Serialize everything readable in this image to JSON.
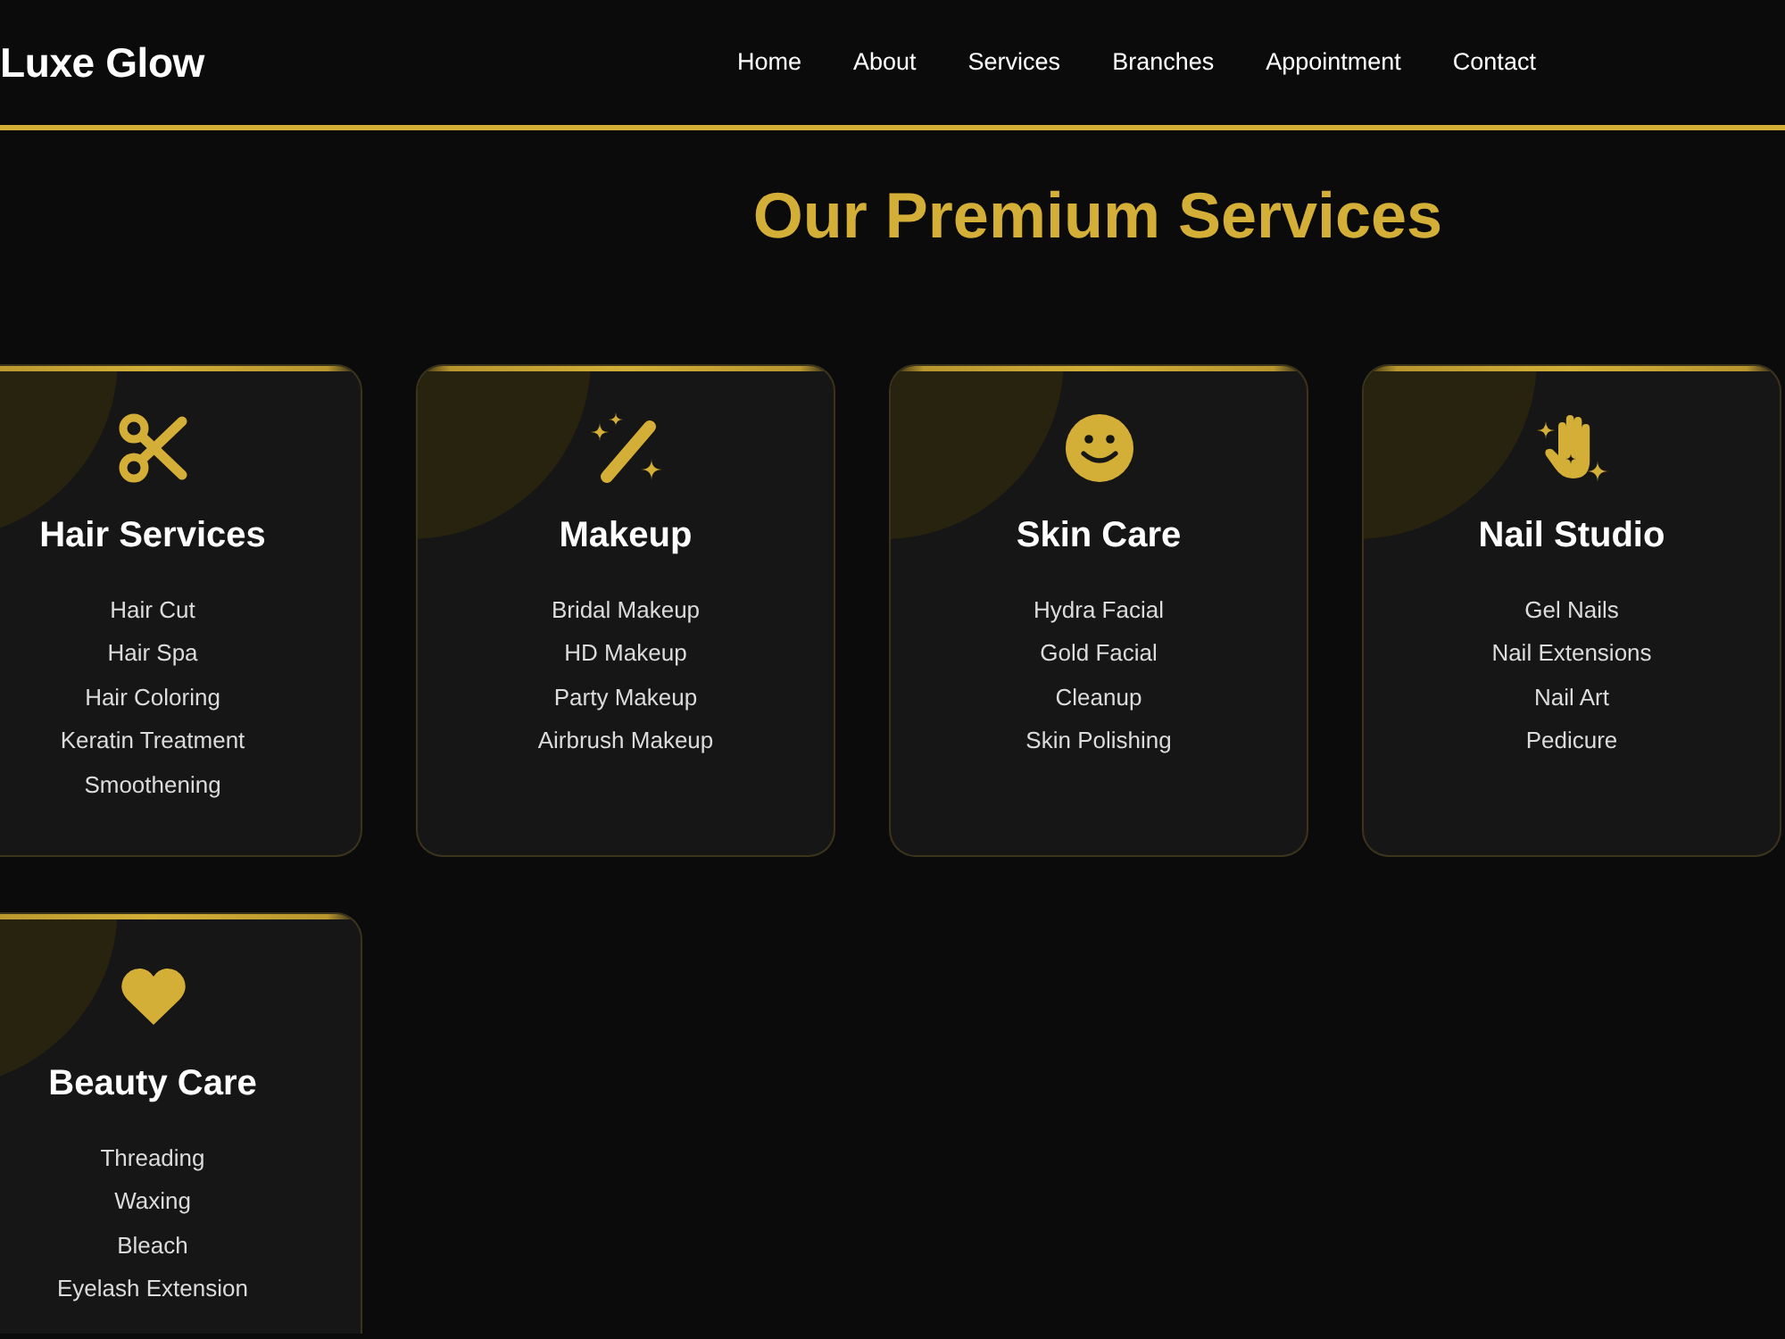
{
  "header": {
    "logo": "Luxe Glow",
    "nav": [
      "Home",
      "About",
      "Services",
      "Branches",
      "Appointment",
      "Contact"
    ]
  },
  "services": {
    "title": "Our Premium Services",
    "cards": [
      {
        "title": "Hair Services",
        "items": [
          "Hair Cut",
          "Hair Spa",
          "Hair Coloring",
          "Keratin Treatment",
          "Smoothening"
        ]
      },
      {
        "title": "Makeup",
        "items": [
          "Bridal Makeup",
          "HD Makeup",
          "Party Makeup",
          "Airbrush Makeup"
        ]
      },
      {
        "title": "Skin Care",
        "items": [
          "Hydra Facial",
          "Gold Facial",
          "Cleanup",
          "Skin Polishing"
        ]
      },
      {
        "title": "Nail Studio",
        "items": [
          "Gel Nails",
          "Nail Extensions",
          "Nail Art",
          "Pedicure"
        ]
      },
      {
        "title": "Beauty Care",
        "items": [
          "Threading",
          "Waxing",
          "Bleach",
          "Eyelash Extension"
        ]
      }
    ]
  }
}
